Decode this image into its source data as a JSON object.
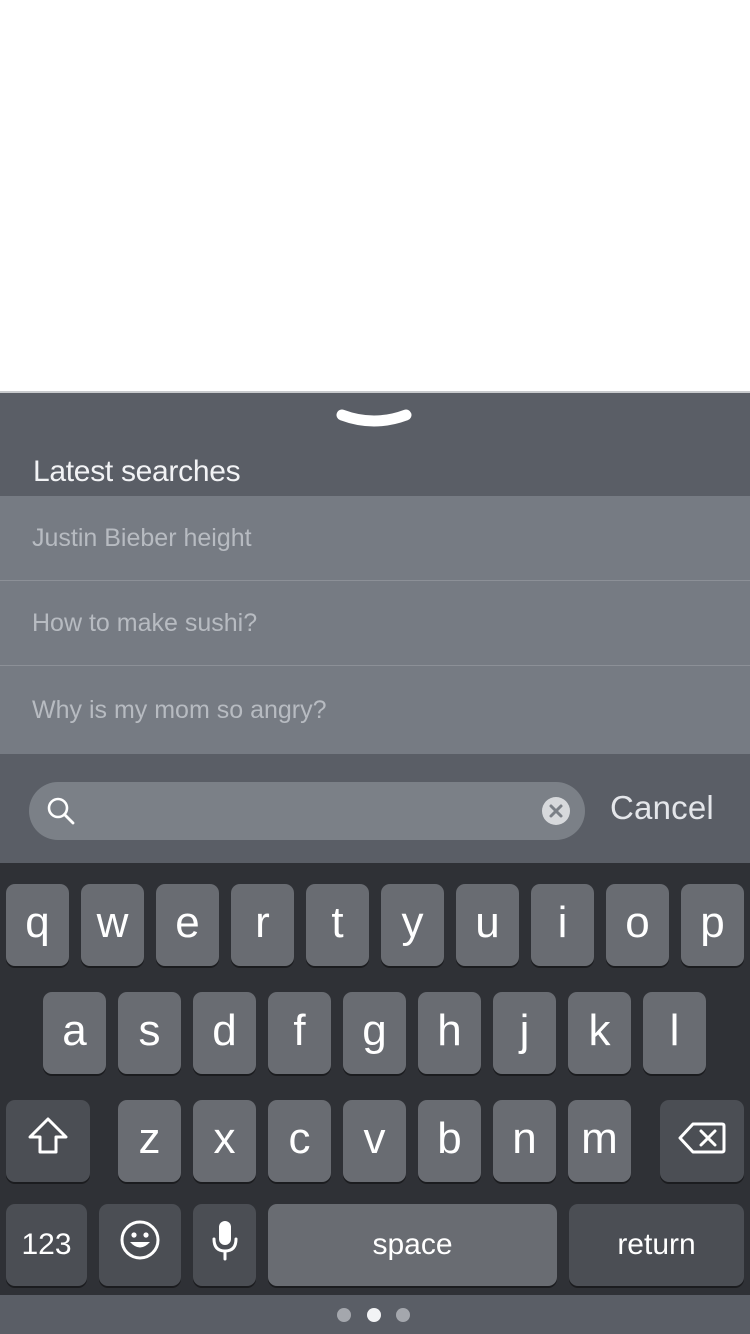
{
  "recent": {
    "title": "Latest searches",
    "items": [
      {
        "label": "Justin Bieber height"
      },
      {
        "label": "How to make sushi?"
      },
      {
        "label": "Why is my mom so angry?"
      }
    ]
  },
  "search": {
    "value": "",
    "placeholder": "",
    "cancel_label": "Cancel"
  },
  "keyboard": {
    "row1": [
      "q",
      "w",
      "e",
      "r",
      "t",
      "y",
      "u",
      "i",
      "o",
      "p"
    ],
    "row2": [
      "a",
      "s",
      "d",
      "f",
      "g",
      "h",
      "j",
      "k",
      "l"
    ],
    "row3": [
      "z",
      "x",
      "c",
      "v",
      "b",
      "n",
      "m"
    ],
    "numbers_label": "123",
    "space_label": "space",
    "return_label": "return"
  },
  "icons": {
    "handle": "chevron-down-icon",
    "search": "search-icon",
    "clear": "clear-icon",
    "shift": "shift-icon",
    "delete": "backspace-icon",
    "emoji": "emoji-icon",
    "mic": "microphone-icon"
  },
  "page_indicator": {
    "count": 3,
    "active_index": 1
  },
  "colors": {
    "sheet": "#5a5e66",
    "list_item": "#767b83",
    "keyboard": "#2f3136",
    "key": "#696c72"
  }
}
